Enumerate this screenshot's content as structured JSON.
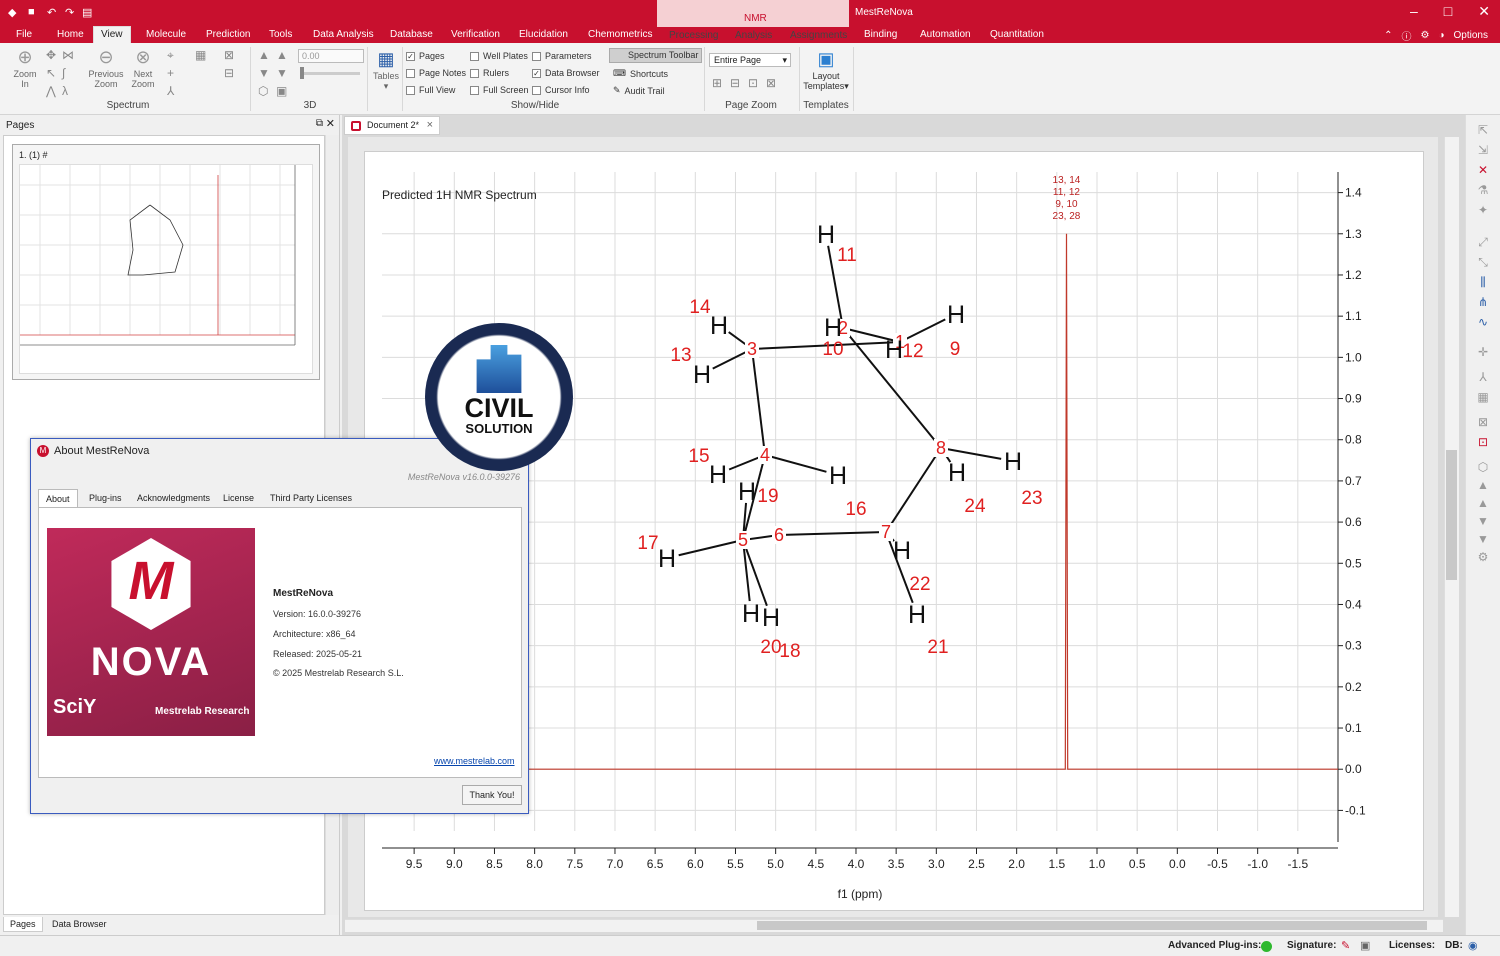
{
  "app": {
    "title": "MestReNova",
    "context_group": "NMR"
  },
  "menu": {
    "tabs": [
      "File",
      "Home",
      "View",
      "Molecule",
      "Prediction",
      "Tools",
      "Data Analysis",
      "Database",
      "Verification",
      "Elucidation",
      "Chemometrics",
      "Processing",
      "Analysis",
      "Assignments",
      "Binding",
      "Automation",
      "Quantitation"
    ],
    "active": "View",
    "options": "Options"
  },
  "ribbon": {
    "spectrum": {
      "zoom_in": [
        "Zoom",
        "In"
      ],
      "previous_zoom": [
        "Previous",
        "Zoom"
      ],
      "next_zoom": [
        "Next",
        "Zoom"
      ],
      "label": "Spectrum"
    },
    "three_d": {
      "value": "0.00",
      "label": "3D"
    },
    "tables": "Tables",
    "show_hide": {
      "label": "Show/Hide",
      "checks": [
        {
          "text": "Pages",
          "checked": true
        },
        {
          "text": "Page Notes",
          "checked": false
        },
        {
          "text": "Full View",
          "checked": false
        },
        {
          "text": "Well Plates",
          "checked": false
        },
        {
          "text": "Rulers",
          "checked": false
        },
        {
          "text": "Full Screen",
          "checked": false
        },
        {
          "text": "Parameters",
          "checked": false
        },
        {
          "text": "Data Browser",
          "checked": true
        },
        {
          "text": "Cursor Info",
          "checked": false
        }
      ],
      "spectrum_toolbar": "Spectrum Toolbar",
      "shortcuts": "Shortcuts",
      "audit_trail": "Audit Trail"
    },
    "page_zoom": {
      "value": "Entire Page",
      "label": "Page Zoom"
    },
    "templates": {
      "button": [
        "Layout",
        "Templates"
      ],
      "label": "Templates"
    }
  },
  "pages_panel": {
    "title": "Pages",
    "thumb_label": "1. (1)  #",
    "tabs": [
      "Pages",
      "Data Browser"
    ]
  },
  "document": {
    "tab": "Document 2*"
  },
  "watermark": {
    "line1": "CIVIL",
    "line2": "SOLUTION",
    "top_arc": "SMART SOLUTION OF CIVIL",
    "bottom_arc": "YOUR GUIDE TO ENGINEERING SOFTWARES"
  },
  "chart_data": {
    "type": "line",
    "title": "Predicted 1H NMR Spectrum",
    "xlabel": "f1 (ppm)",
    "ylabel": "",
    "xlim": [
      9.9,
      -2.0
    ],
    "ylim": [
      -0.15,
      1.45
    ],
    "x_ticks": [
      9.5,
      9.0,
      8.5,
      8.0,
      7.5,
      7.0,
      6.5,
      6.0,
      5.5,
      5.0,
      4.5,
      4.0,
      3.5,
      3.0,
      2.5,
      2.0,
      1.5,
      1.0,
      0.5,
      0.0,
      -0.5,
      -1.0,
      -1.5
    ],
    "y_ticks": [
      1.4,
      1.3,
      1.2,
      1.1,
      1.0,
      0.9,
      0.8,
      0.7,
      0.6,
      0.5,
      0.4,
      0.3,
      0.2,
      0.1,
      0.0,
      -0.1
    ],
    "grid": true,
    "series": [
      {
        "points": [
          [
            9.9,
            0
          ],
          [
            1.395,
            0
          ],
          [
            1.38,
            1.3
          ],
          [
            1.365,
            0
          ],
          [
            -2.0,
            0
          ]
        ],
        "color": "#c0392b"
      }
    ],
    "peak_labels": {
      "x": 1.38,
      "lines": [
        "13, 14",
        "11, 12",
        "9, 10",
        "23, 28"
      ]
    }
  },
  "molecule": {
    "bonds": [
      [
        0,
        1
      ],
      [
        0,
        2
      ],
      [
        2,
        3
      ],
      [
        3,
        4
      ],
      [
        4,
        5
      ],
      [
        5,
        6
      ],
      [
        6,
        7
      ],
      [
        7,
        1
      ]
    ],
    "carbons": [
      "1",
      "2",
      "3",
      "4",
      "5",
      "6",
      "7",
      "8"
    ],
    "hydrogens": [
      [
        "H",
        "11"
      ],
      [
        "H",
        "10"
      ],
      [
        "H",
        "12"
      ],
      [
        "H",
        "9"
      ],
      [
        "H",
        "14"
      ],
      [
        "H",
        "13"
      ],
      [
        "H",
        "15"
      ],
      [
        "H",
        "16"
      ],
      [
        "H",
        "19"
      ],
      [
        "H",
        "17"
      ],
      [
        "H",
        "20"
      ],
      [
        "H",
        "18"
      ],
      [
        "H",
        "22"
      ],
      [
        "H",
        "21"
      ],
      [
        "H",
        "24"
      ],
      [
        "H",
        "23"
      ]
    ]
  },
  "about": {
    "title": "About MestReNova",
    "version_line": "MestReNova v16.0.0-39276",
    "tabs": [
      "About",
      "Plug-ins",
      "Acknowledgments",
      "License",
      "Third Party Licenses"
    ],
    "logo_text": "NOVA",
    "logo_sciy": "SciY",
    "logo_brand": "Mestrelab Research",
    "name": "MestReNova",
    "version": "Version: 16.0.0-39276",
    "architecture": "Architecture: x86_64",
    "released": "Released: 2025-05-21",
    "copyright": "© 2025 Mestrelab Research S.L.",
    "link": "www.mestrelab.com",
    "button": "Thank You!"
  },
  "status": {
    "plugins": "Advanced Plug-ins:",
    "signature": "Signature:",
    "licenses": "Licenses:",
    "db": "DB:",
    "plugin_color": "#2eb82e"
  },
  "colors": {
    "brand": "#c8102e",
    "spectrum": "#c0392b",
    "labels": "#e02020"
  }
}
